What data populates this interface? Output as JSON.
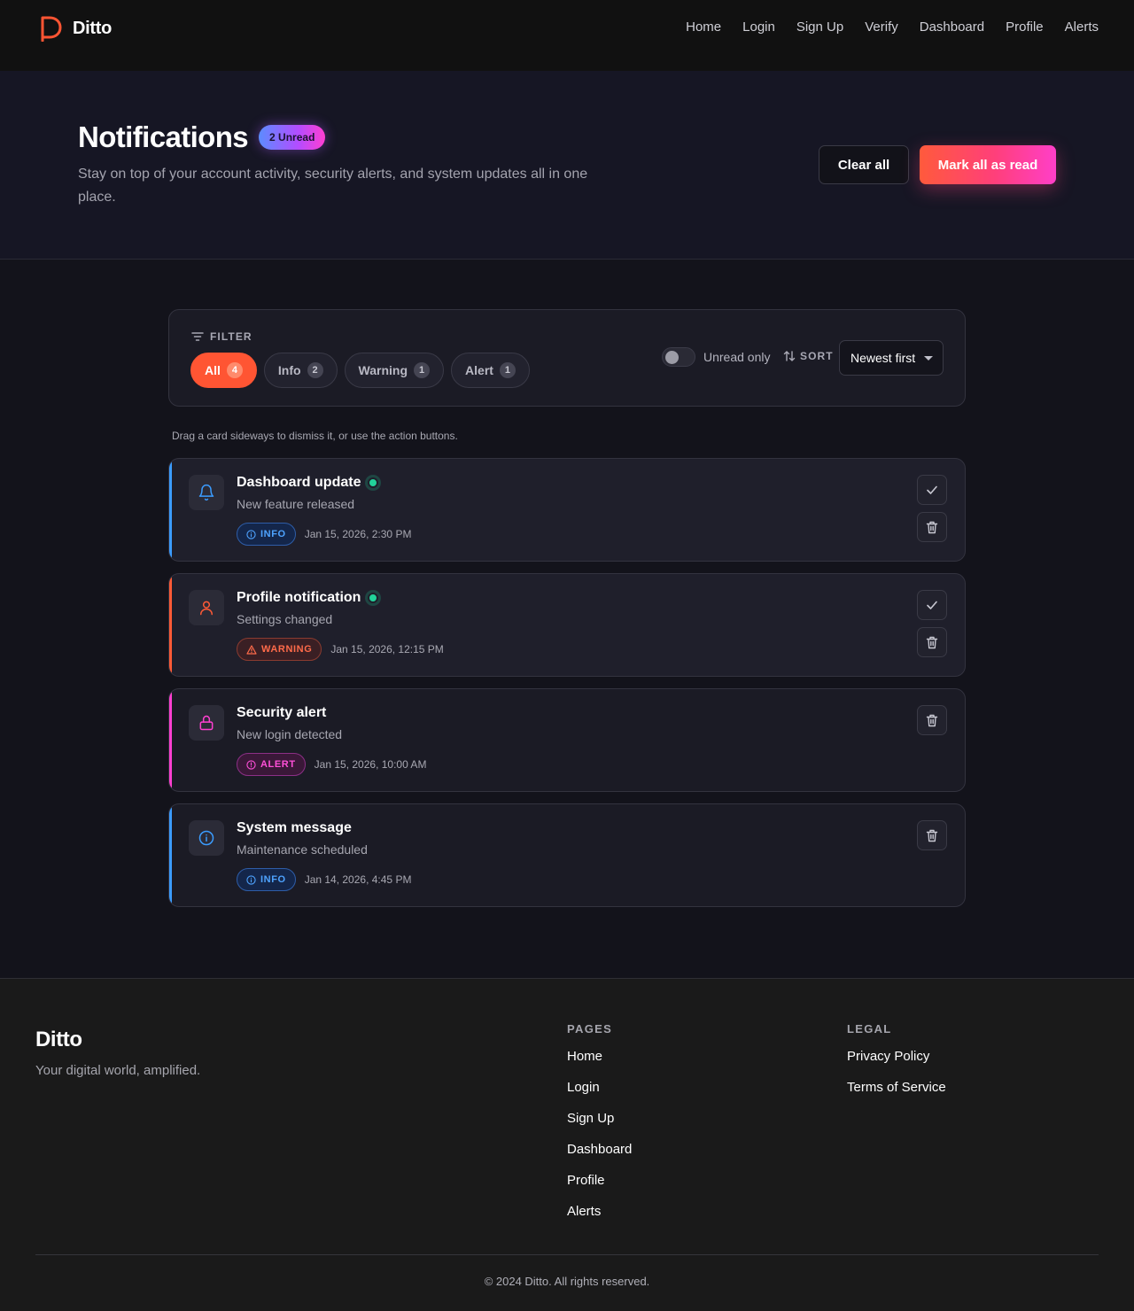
{
  "brand": {
    "name": "Ditto",
    "accent": "#ff5533"
  },
  "nav": {
    "links": [
      "Home",
      "Login",
      "Sign Up",
      "Verify",
      "Dashboard",
      "Profile",
      "Alerts"
    ]
  },
  "hero": {
    "title": "Notifications",
    "unread_badge": "2 Unread",
    "subtitle": "Stay on top of your account activity, security alerts, and system updates all in one place.",
    "clear_label": "Clear all",
    "mark_label": "Mark all as read"
  },
  "filter": {
    "label": "FILTER",
    "chips": [
      {
        "label": "All",
        "count": "4",
        "active": true
      },
      {
        "label": "Info",
        "count": "2",
        "active": false
      },
      {
        "label": "Warning",
        "count": "1",
        "active": false
      },
      {
        "label": "Alert",
        "count": "1",
        "active": false
      }
    ],
    "unread_only_label": "Unread only",
    "unread_only_on": false,
    "sort_label": "SORT",
    "sort_value": "Newest first"
  },
  "hint": "Drag a card sideways to dismiss it, or use the action buttons.",
  "notifications": [
    {
      "title": "Dashboard update",
      "message": "New feature released",
      "type": "INFO",
      "time": "Jan 15, 2026, 2:30 PM",
      "unread": true,
      "icon": "bell-icon",
      "color": "#3b9cff"
    },
    {
      "title": "Profile notification",
      "message": "Settings changed",
      "type": "WARNING",
      "time": "Jan 15, 2026, 12:15 PM",
      "unread": true,
      "icon": "user-icon",
      "color": "#ff5a36"
    },
    {
      "title": "Security alert",
      "message": "New login detected",
      "type": "ALERT",
      "time": "Jan 15, 2026, 10:00 AM",
      "unread": false,
      "icon": "lock-icon",
      "color": "#ff3fd1"
    },
    {
      "title": "System message",
      "message": "Maintenance scheduled",
      "type": "INFO",
      "time": "Jan 14, 2026, 4:45 PM",
      "unread": false,
      "icon": "info-circle-icon",
      "color": "#3b9cff"
    }
  ],
  "footer": {
    "brand": "Ditto",
    "tagline": "Your digital world, amplified.",
    "pages_heading": "PAGES",
    "pages": [
      "Home",
      "Login",
      "Sign Up",
      "Dashboard",
      "Profile",
      "Alerts"
    ],
    "legal_heading": "LEGAL",
    "legal": [
      "Privacy Policy",
      "Terms of Service"
    ],
    "copyright": "© 2024 Ditto. All rights reserved."
  }
}
